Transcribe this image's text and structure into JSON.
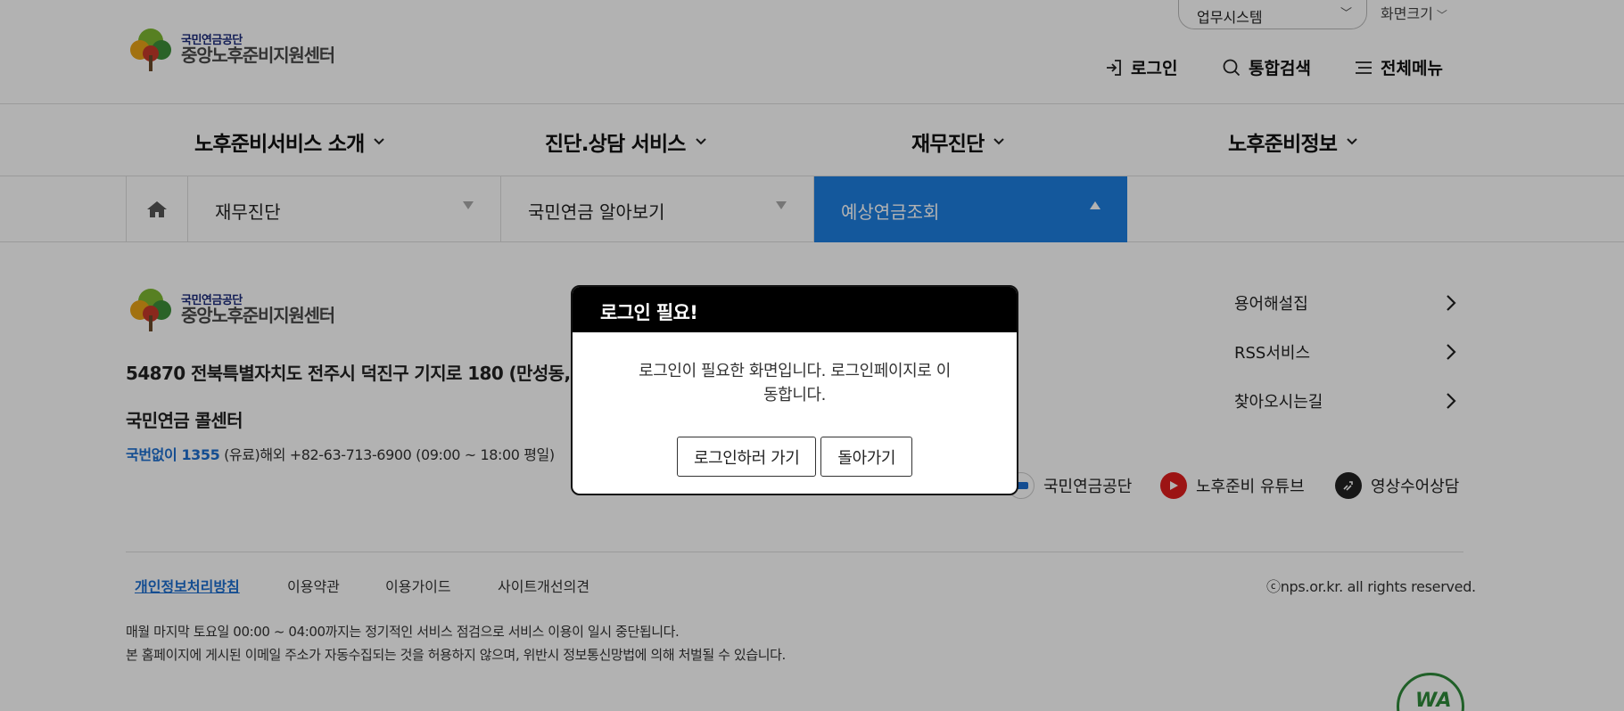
{
  "header": {
    "logo": {
      "line1": "국민연금공단",
      "line2": "중앙노후준비지원센터"
    },
    "biz_select": "업무시스템",
    "screen_size": "화면크기",
    "util": {
      "login": "로그인",
      "search": "통합검색",
      "menu": "전체메뉴"
    }
  },
  "gnb": [
    "노후준비서비스 소개",
    "진단.상담 서비스",
    "재무진단",
    "노후준비정보"
  ],
  "subnav": {
    "items": [
      "재무진단",
      "국민연금 알아보기",
      "예상연금조회"
    ]
  },
  "footer": {
    "logo": {
      "line1": "국민연금공단",
      "line2": "중앙노후준비지원센터"
    },
    "address": "54870 전북특별자치도 전주시 덕진구 기지로 180 (만성동, 국",
    "callcenter_title": "국민연금 콜센터",
    "phone_blue": "국번없이 1355",
    "phone_rest": " (유료)해외 +82-63-713-6900   (09:00 ~ 18:00 평일)",
    "quick_links": [
      "용어해설집",
      "RSS서비스",
      "찾아오시는길"
    ],
    "sns": [
      "국민연금공단",
      "노후준비 유튜브",
      "영상수어상담"
    ],
    "links": [
      "개인정보처리방침",
      "이용약관",
      "이용가이드",
      "사이트개선의견"
    ],
    "copyright": "ⓒnps.or.kr. all rights reserved.",
    "notice1": "매월 마지막 토요일 00:00 ~ 04:00까지는 정기적인 서비스 점검으로 서비스 이용이 일시 중단됩니다.",
    "notice2": "본 홈페이지에 게시된 이메일 주소가 자동수집되는 것을 허용하지 않으며, 위반시 정보통신망법에 의해 처벌될 수 있습니다."
  },
  "modal": {
    "title": "로그인 필요!",
    "message": "로그인이 필요한 화면입니다. 로그인페이지로 이동합니다.",
    "confirm": "로그인하러 가기",
    "cancel": "돌아가기"
  },
  "colors": {
    "accent": "#1d7fe0",
    "link": "#1d6fd0",
    "overlay": "rgba(0,0,0,0.30)"
  }
}
